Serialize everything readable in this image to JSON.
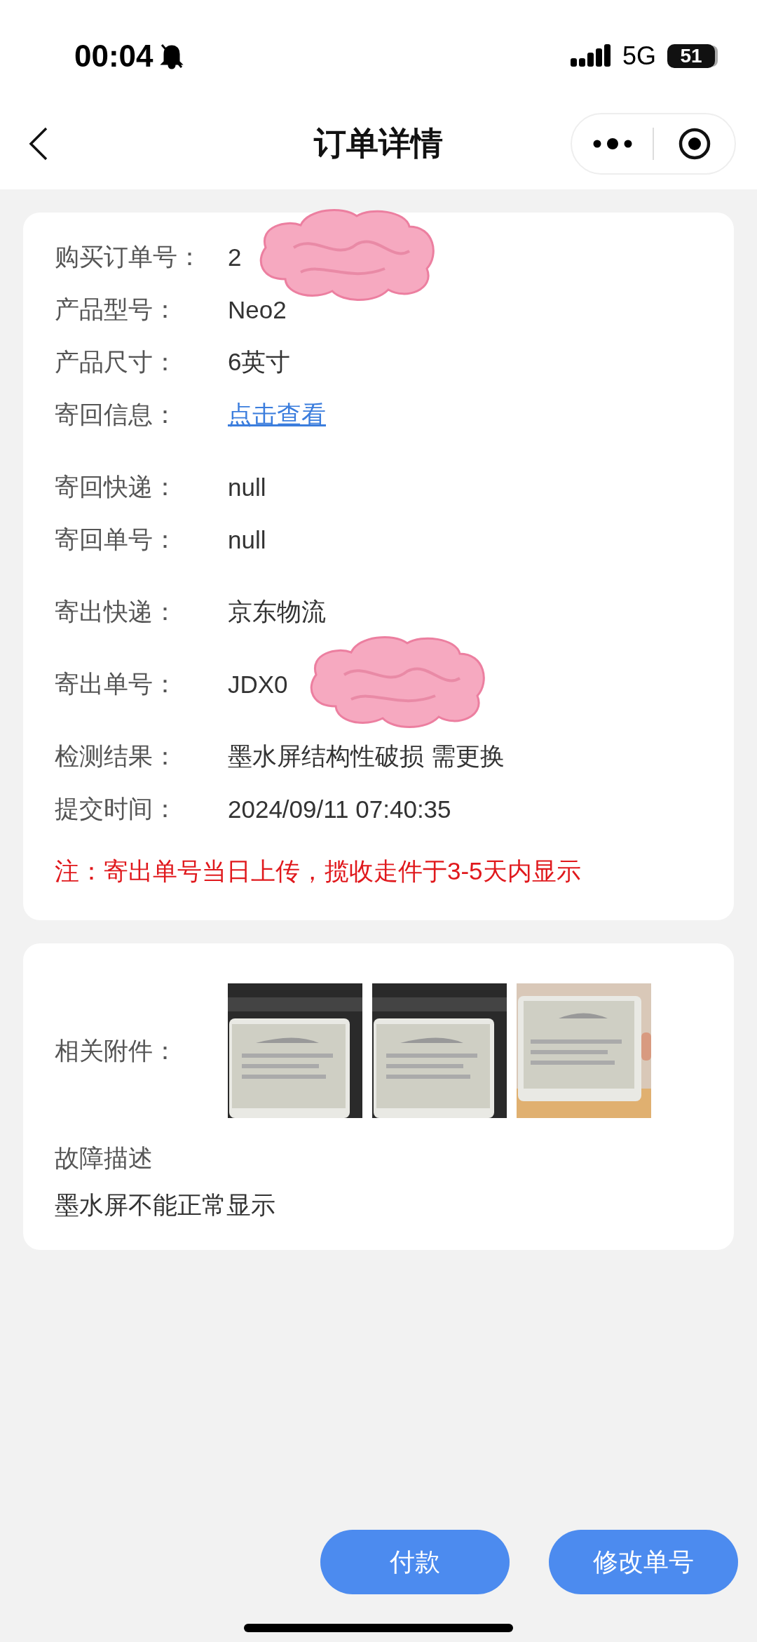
{
  "status_bar": {
    "time": "00:04",
    "network": "5G",
    "battery": "51"
  },
  "nav": {
    "title": "订单详情"
  },
  "order_card": {
    "groups": [
      [
        {
          "label": "购买订单号：",
          "value": "2",
          "kind": "text",
          "redacted": true
        },
        {
          "label": "产品型号：",
          "value": "Neo2",
          "kind": "text",
          "redacted": false
        },
        {
          "label": "产品尺寸：",
          "value": "6英寸",
          "kind": "text",
          "redacted": false
        },
        {
          "label": "寄回信息：",
          "value": "点击查看",
          "kind": "link",
          "redacted": false
        }
      ],
      [
        {
          "label": "寄回快递：",
          "value": "null",
          "kind": "text",
          "redacted": false
        },
        {
          "label": "寄回单号：",
          "value": "null",
          "kind": "text",
          "redacted": false
        }
      ],
      [
        {
          "label": "寄出快递：",
          "value": "京东物流",
          "kind": "text",
          "redacted": false
        }
      ],
      [
        {
          "label": "寄出单号：",
          "value": "JDX0",
          "kind": "text",
          "redacted": true
        }
      ],
      [
        {
          "label": "检测结果：",
          "value": "墨水屏结构性破损 需更换",
          "kind": "text",
          "redacted": false
        },
        {
          "label": "提交时间：",
          "value": "2024/09/11 07:40:35",
          "kind": "text",
          "redacted": false
        }
      ]
    ],
    "note": "注：寄出单号当日上传，揽收走件于3-5天内显示"
  },
  "attachments_card": {
    "label": "相关附件：",
    "fault_title": "故障描述",
    "fault_text": "墨水屏不能正常显示"
  },
  "buttons": [
    {
      "label": "付款"
    },
    {
      "label": "修改单号"
    }
  ]
}
